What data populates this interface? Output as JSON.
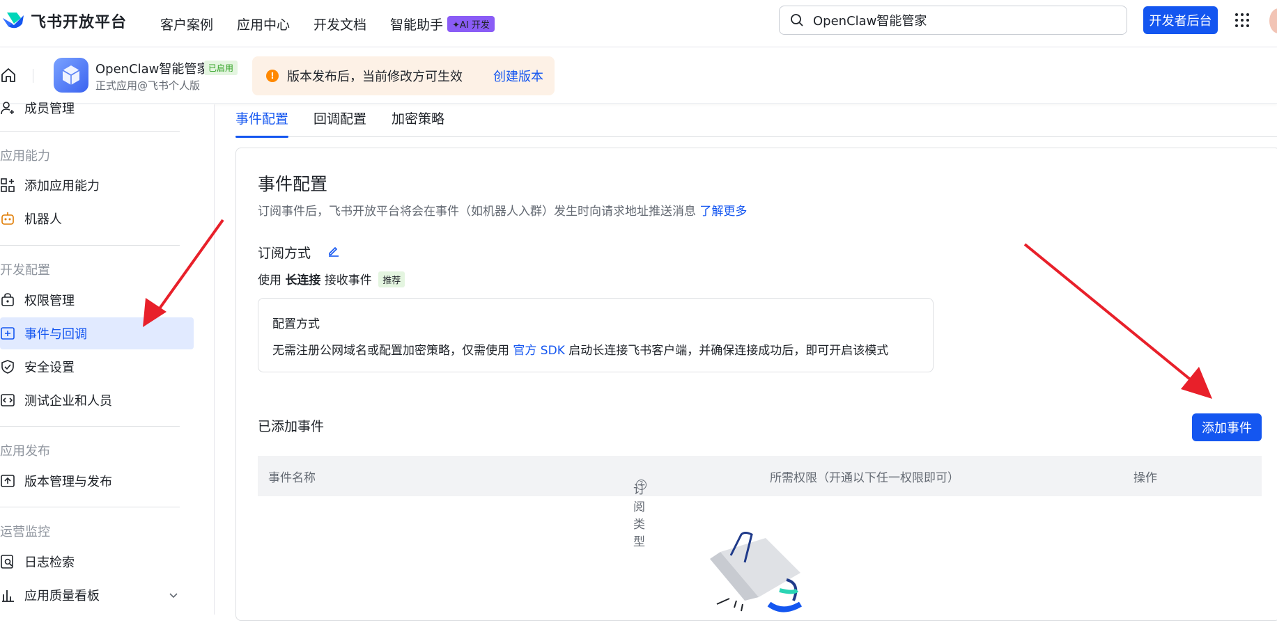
{
  "header": {
    "logo_text": "飞书开放平台",
    "nav": [
      "客户案例",
      "应用中心",
      "开发文档",
      "智能助手"
    ],
    "ai_badge": "✦AI 开发",
    "search_value": "OpenClaw智能管家",
    "dev_button": "开发者后台"
  },
  "app": {
    "name": "OpenClaw智能管家",
    "status": "已启用",
    "subtitle": "正式应用@飞书个人版",
    "notice_text": "版本发布后，当前修改方可生效",
    "notice_link": "创建版本"
  },
  "sidebar": {
    "member_item": "成员管理",
    "group_ability": "应用能力",
    "add_ability": "添加应用能力",
    "bot": "机器人",
    "group_dev": "开发配置",
    "permissions": "权限管理",
    "events": "事件与回调",
    "security": "安全设置",
    "test_users": "测试企业和人员",
    "group_release": "应用发布",
    "versions": "版本管理与发布",
    "group_ops": "运营监控",
    "logs": "日志检索",
    "quality": "应用质量看板"
  },
  "tabs": [
    "事件配置",
    "回调配置",
    "加密策略"
  ],
  "main": {
    "title": "事件配置",
    "desc": "订阅事件后，飞书开放平台将会在事件（如机器人入群）发生时向请求地址推送消息",
    "desc_link": "了解更多",
    "subscribe_heading": "订阅方式",
    "use_prefix": "使用",
    "use_bold": "长连接",
    "use_suffix": "接收事件",
    "recommend": "推荐",
    "cfg_title": "配置方式",
    "cfg_text_1": "无需注册公网域名或配置加密策略，仅需使用",
    "cfg_link": "官方 SDK",
    "cfg_text_2": "启动长连接飞书客户端，并确保连接成功后，即可开启该模式",
    "added_heading": "已添加事件",
    "add_button": "添加事件",
    "columns": [
      "事件名称",
      "订阅类型",
      "所需权限（开通以下任一权限即可）",
      "操作"
    ]
  },
  "colors": {
    "primary": "#1456f0",
    "arrow": "#e8202a"
  }
}
